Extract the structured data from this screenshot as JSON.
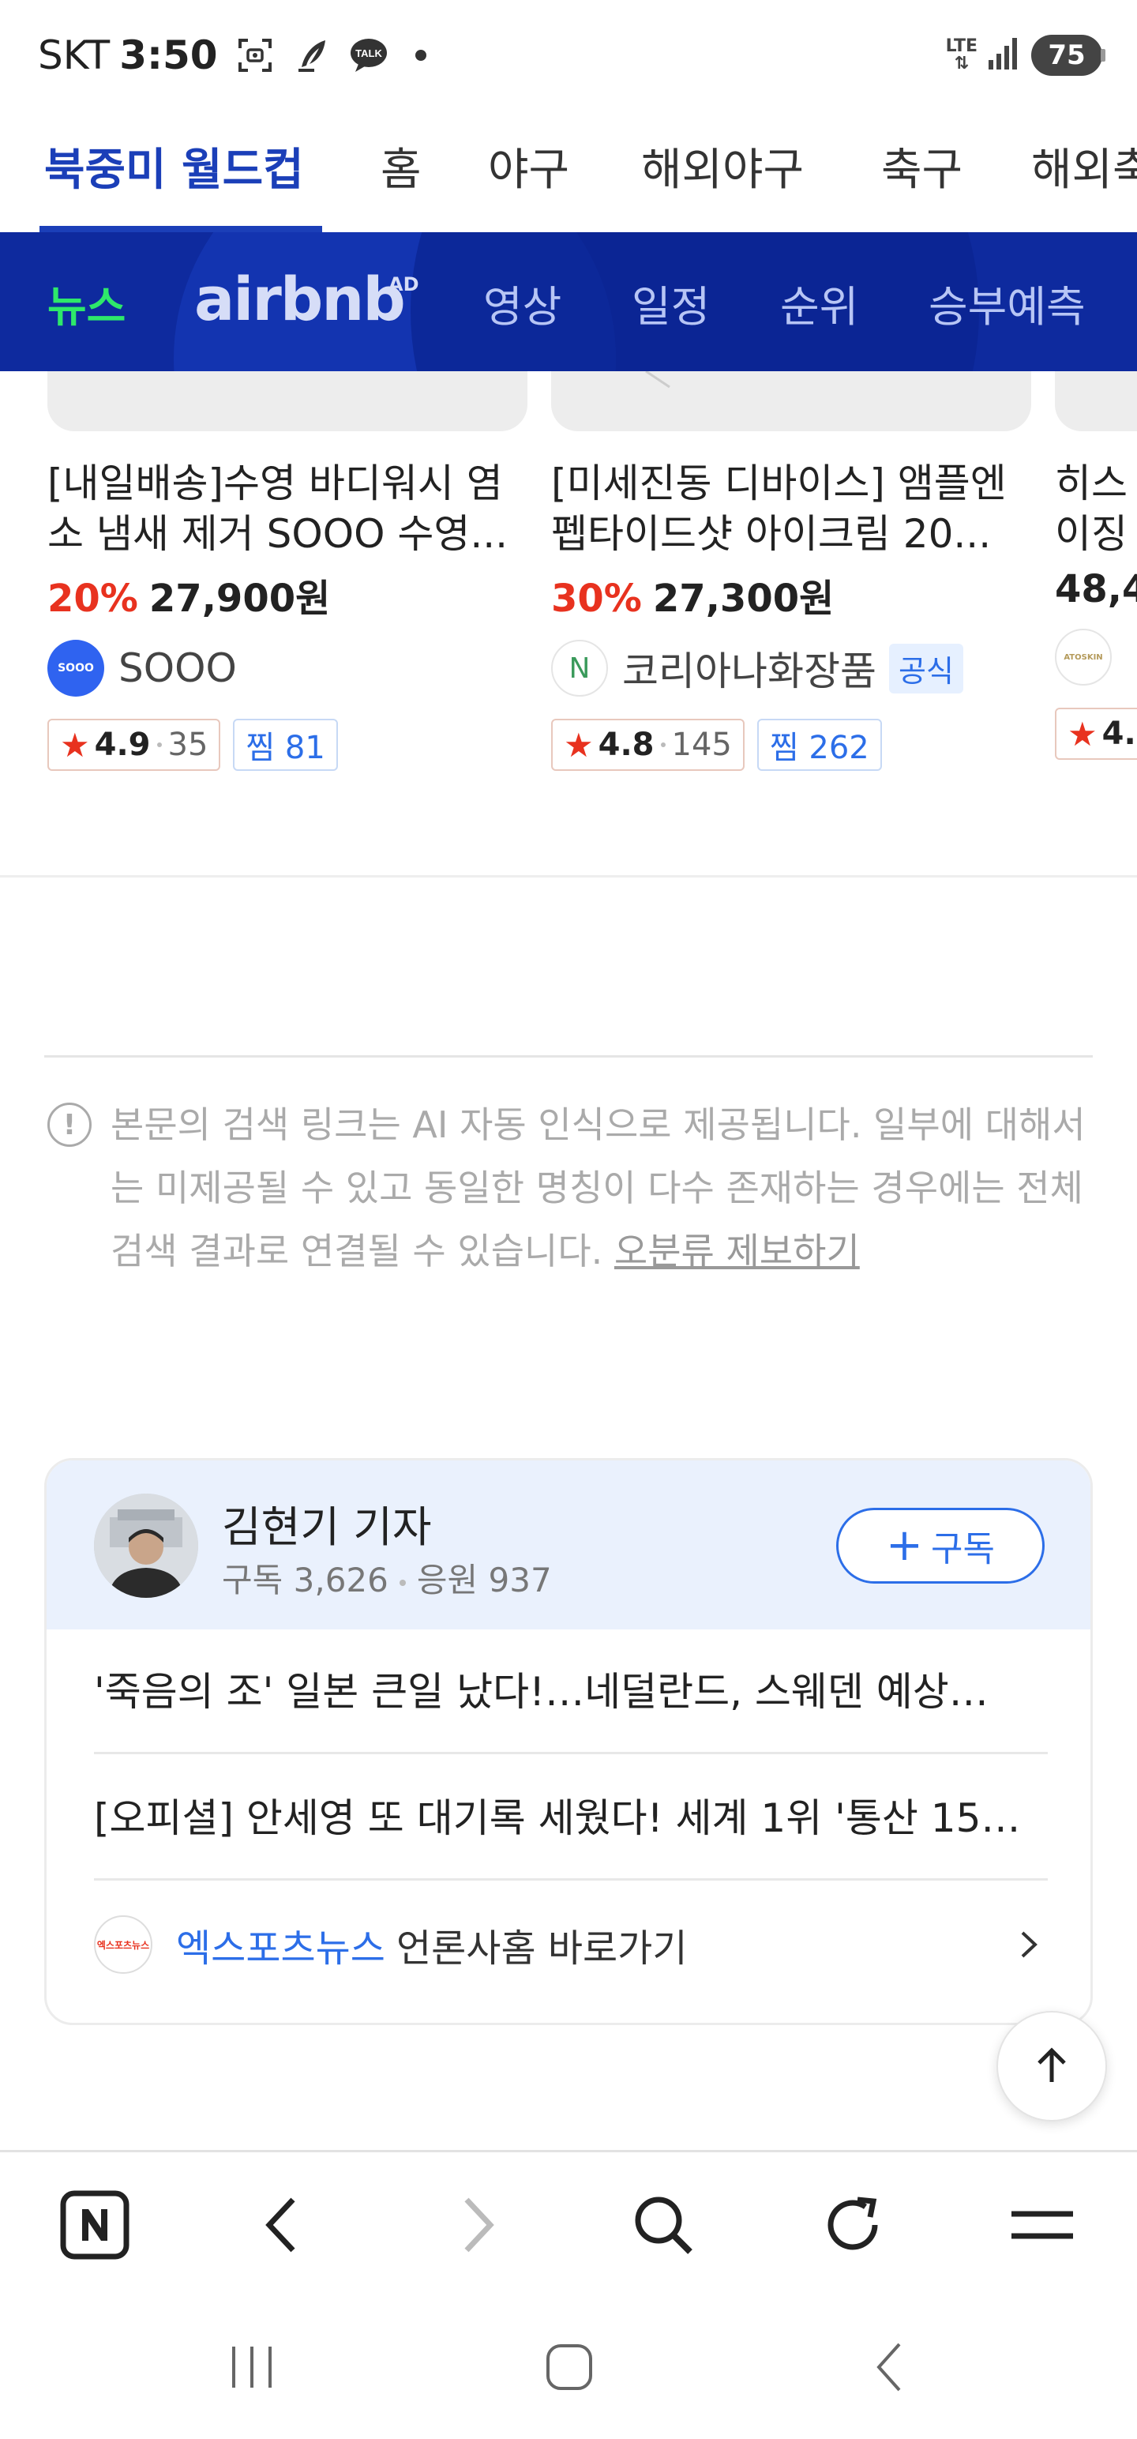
{
  "status_bar": {
    "carrier": "SKT",
    "time": "3:50",
    "network": "LTE",
    "battery": "75",
    "icons": [
      "screenshot-icon",
      "quill-icon",
      "talk-icon",
      "notification-dot-icon",
      "lte-icon",
      "signal-icon",
      "battery-icon"
    ]
  },
  "category_nav": {
    "items": [
      {
        "label": "북중미 월드컵",
        "active": true
      },
      {
        "label": "홈"
      },
      {
        "label": "야구"
      },
      {
        "label": "해외야구"
      },
      {
        "label": "축구"
      },
      {
        "label": "해외축"
      }
    ]
  },
  "sub_nav": {
    "items": [
      {
        "label": "뉴스",
        "active": true
      },
      {
        "label": "영상"
      },
      {
        "label": "일정"
      },
      {
        "label": "순위"
      },
      {
        "label": "승부예측"
      }
    ],
    "ad": {
      "brand": "airbnb",
      "tag": "AD"
    }
  },
  "products": [
    {
      "title_line1": "[내일배송]수영 바디워시 염",
      "title_line2": "소 냄새 제거 SOOO 수영...",
      "discount": "20%",
      "price": "27,900원",
      "seller": "SOOO",
      "seller_logo_text": "SOOO",
      "official": "",
      "rating": "4.9",
      "reviews": "35",
      "zzim": "찜 81"
    },
    {
      "title_line1": "[미세진동 디바이스] 앰플엔",
      "title_line2": "펩타이드샷 아이크림 20...",
      "discount": "30%",
      "price": "27,300원",
      "seller": "코리아나화장품",
      "seller_logo_text": "N",
      "official": "공식",
      "rating": "4.8",
      "reviews": "145",
      "zzim": "찜 262"
    },
    {
      "title_line1": "히스",
      "title_line2": "이징",
      "discount": "",
      "price": "48,4",
      "seller": "",
      "seller_logo_text": "ATOSKIN",
      "official": "",
      "rating": "4.",
      "reviews": "",
      "zzim": ""
    }
  ],
  "notice": {
    "line1": "본문의 검색 링크는 AI 자동 인식으로 제공됩니다. 일부에 대해서",
    "line2": "는 미제공될 수 있고 동일한 명칭이 다수 존재하는 경우에는 전체",
    "line3": "검색 결과로 연결될 수 있습니다.",
    "report_link": "오분류 제보하기"
  },
  "journalist": {
    "name": "김현기 기자",
    "subscribers": "구독 3,626",
    "cheers": "응원 937",
    "subscribe_label": "구독",
    "articles": [
      "'죽음의 조' 일본 큰일 났다!…네덜란드, 스웨덴 예상…",
      "[오피셜] 안세영 또 대기록 세웠다! 세계 1위 '통산 15…"
    ],
    "press_name": "엑스포츠뉴스",
    "press_home": "언론사홈 바로가기",
    "press_logo_text": "엑스포츠뉴스"
  },
  "toolbar": {
    "buttons": [
      "naver-home-icon",
      "back-icon",
      "forward-icon",
      "search-icon",
      "refresh-icon",
      "menu-icon"
    ]
  },
  "system_nav": {
    "buttons": [
      "recent-apps-icon",
      "home-icon",
      "system-back-icon"
    ]
  },
  "colors": {
    "brand_blue": "#1b3fb8",
    "sub_nav_bg": "#0e2a9e",
    "active_green": "#2ee86a",
    "discount_red": "#e8321f",
    "link_blue": "#2c6ee8"
  }
}
